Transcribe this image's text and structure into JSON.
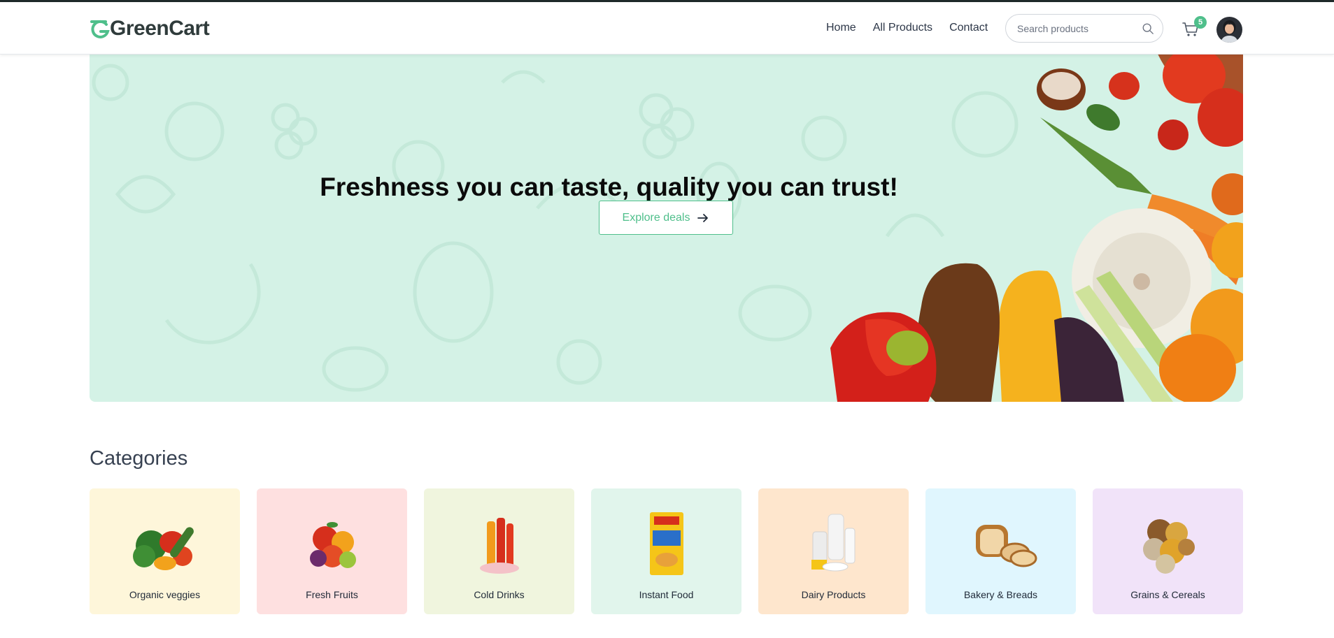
{
  "brand": {
    "name": "GreenCart",
    "accent": "#4fbf8b"
  },
  "nav": {
    "links": [
      "Home",
      "All Products",
      "Contact"
    ]
  },
  "search": {
    "placeholder": "Search products"
  },
  "cart": {
    "count": "5"
  },
  "hero": {
    "title": "Freshness you can taste, quality you can trust!",
    "cta_label": "Explore deals",
    "background": "#d4f2e6"
  },
  "categories": {
    "heading": "Categories",
    "items": [
      {
        "label": "Organic veggies",
        "bg": "#fef6da",
        "icon": "veggies-image"
      },
      {
        "label": "Fresh Fruits",
        "bg": "#fee0e0",
        "icon": "fruits-image"
      },
      {
        "label": "Cold Drinks",
        "bg": "#f0f5de",
        "icon": "drinks-image"
      },
      {
        "label": "Instant Food",
        "bg": "#e1f5ec",
        "icon": "instant-food-image"
      },
      {
        "label": "Dairy Products",
        "bg": "#fee6cd",
        "icon": "dairy-image"
      },
      {
        "label": "Bakery & Breads",
        "bg": "#e0f6fe",
        "icon": "bread-image"
      },
      {
        "label": "Grains & Cereals",
        "bg": "#f1e3f9",
        "icon": "grains-image"
      }
    ]
  }
}
